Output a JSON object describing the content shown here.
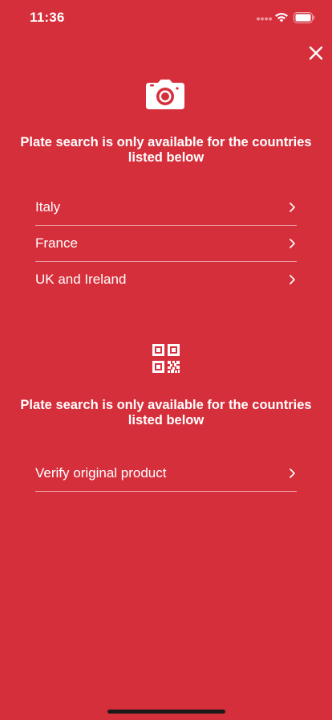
{
  "status_bar": {
    "time": "11:36"
  },
  "colors": {
    "background": "#d62f3c",
    "foreground": "#ffffff",
    "divider": "#f1a8ae"
  },
  "icons": {
    "close": "close-icon",
    "camera": "camera-icon",
    "qr": "qr-code-icon",
    "chevron": "chevron-right-icon"
  },
  "plate_section": {
    "title": "Plate search is only available for the countries listed below",
    "items": [
      {
        "label": "Italy"
      },
      {
        "label": "France"
      },
      {
        "label": "UK and Ireland"
      }
    ]
  },
  "qr_section": {
    "title": "Plate search is only available for the countries listed below",
    "items": [
      {
        "label": "Verify original product"
      }
    ]
  }
}
